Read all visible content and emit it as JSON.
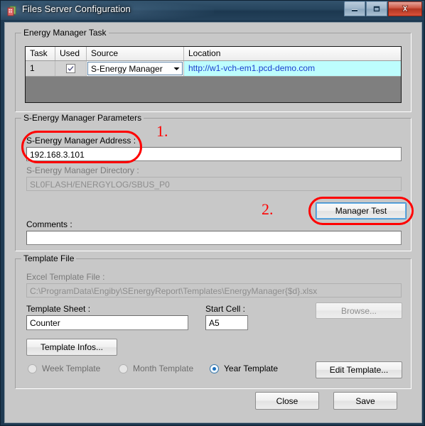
{
  "window": {
    "title": "Files Server Configuration",
    "icon": "files-server-icon",
    "controls": {
      "minimize": "minimize-icon",
      "maximize": "maximize-icon",
      "close": "close-icon"
    },
    "frame_color": "#1e3a52",
    "close_color": "#c53c26"
  },
  "groups": {
    "energy_manager_task": {
      "title": "Energy Manager Task"
    },
    "parameters": {
      "title": "S-Energy Manager Parameters"
    },
    "template_file": {
      "title": "Template File"
    }
  },
  "task_grid": {
    "columns": [
      "Task",
      "Used",
      "Source",
      "Location"
    ],
    "rows": [
      {
        "task": "1",
        "used": true,
        "source": "S-Energy Manager",
        "source_options": [
          "S-Energy Manager"
        ],
        "location": "http://w1-vch-em1.pcd-demo.com"
      }
    ],
    "link_color": "#1b3fd0",
    "row_highlight_color": "#bdfdfd",
    "empty_area_color": "#7f7f7f"
  },
  "parameters": {
    "address_label": "S-Energy Manager Address :",
    "address_value": "192.168.3.101",
    "directory_label": "S-Energy Manager Directory :",
    "directory_value": "SL0FLASH/ENERGYLOG/SBUS_P0",
    "comments_label": "Comments :",
    "comments_value": "",
    "manager_test_button": "Manager Test"
  },
  "template": {
    "excel_file_label": "Excel Template File :",
    "excel_file_value": "C:\\ProgramData\\Engiby\\SEnergyReport\\Templates\\EnergyManager{$d}.xlsx",
    "sheet_label": "Template Sheet :",
    "sheet_value": "Counter",
    "start_cell_label": "Start Cell :",
    "start_cell_value": "A5",
    "browse_button": "Browse...",
    "template_infos_button": "Template Infos...",
    "edit_template_button": "Edit Template...",
    "radios": [
      {
        "label": "Week Template",
        "selected": false,
        "enabled": false
      },
      {
        "label": "Month Template",
        "selected": false,
        "enabled": false
      },
      {
        "label": "Year Template",
        "selected": true,
        "enabled": true
      }
    ]
  },
  "footer": {
    "close_button": "Close",
    "save_button": "Save"
  },
  "annotations": {
    "color": "#ff0000",
    "items": [
      {
        "number": "1.",
        "target": "address-field"
      },
      {
        "number": "2.",
        "target": "manager-test-button"
      }
    ],
    "one": "1.",
    "two": "2."
  }
}
